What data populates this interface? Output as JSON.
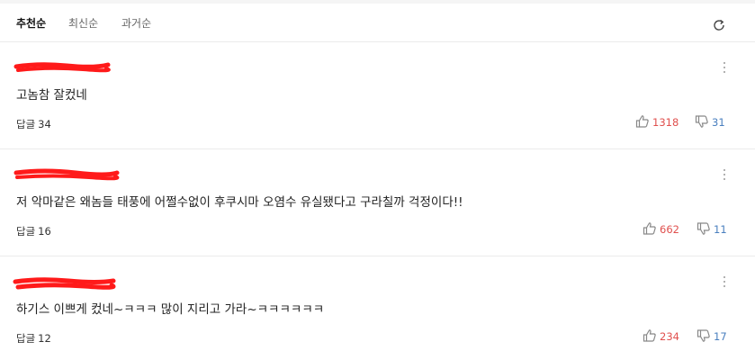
{
  "sort": {
    "tabs": [
      {
        "label": "추천순",
        "active": true
      },
      {
        "label": "최신순",
        "active": false
      },
      {
        "label": "과거순",
        "active": false
      }
    ]
  },
  "icons": {
    "refresh": "refresh-icon",
    "more": "more-vertical-icon",
    "like": "thumbs-up-icon",
    "dislike": "thumbs-down-icon"
  },
  "colors": {
    "like": "#e0504e",
    "dislike": "#4a7fbf",
    "redaction": "#ff1a1a"
  },
  "reply_label": "답글",
  "comments": [
    {
      "author": "redacted",
      "text": "고놈참 잘컸네",
      "replies": "34",
      "likes": "1318",
      "dislikes": "31"
    },
    {
      "author": "redacted",
      "text": "저 악마같은 왜놈들 태풍에 어쩔수없이 후쿠시마 오염수 유실됐다고 구라칠까 걱정이다!!",
      "replies": "16",
      "likes": "662",
      "dislikes": "11"
    },
    {
      "author": "redacted",
      "text": "하기스 이쁘게 컸네~ㅋㅋㅋ 많이 지리고 가라~ㅋㅋㅋㅋㅋㅋ",
      "replies": "12",
      "likes": "234",
      "dislikes": "17"
    }
  ]
}
